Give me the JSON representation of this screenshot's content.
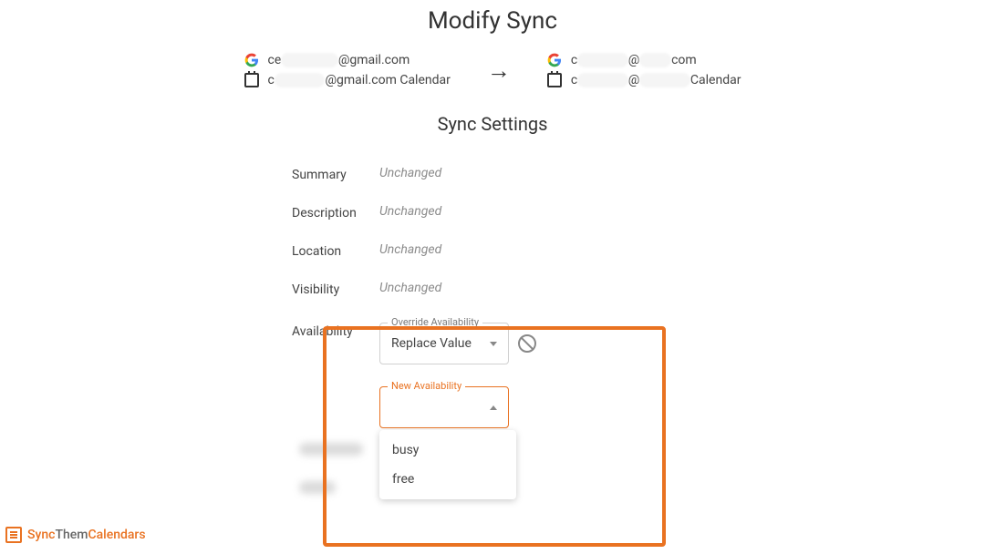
{
  "page_title": "Modify Sync",
  "source_account": {
    "email_prefix": "ce",
    "email_suffix": "@gmail.com",
    "calendar_prefix": "c",
    "calendar_suffix": "@gmail.com Calendar"
  },
  "dest_account": {
    "email_prefix": "c",
    "email_suffix_partial": "@",
    "email_end": "com",
    "calendar_prefix": "c",
    "calendar_suffix_partial": "@",
    "calendar_end": "Calendar"
  },
  "section_title": "Sync Settings",
  "settings": {
    "summary": {
      "label": "Summary",
      "value": "Unchanged"
    },
    "description": {
      "label": "Description",
      "value": "Unchanged"
    },
    "location": {
      "label": "Location",
      "value": "Unchanged"
    },
    "visibility": {
      "label": "Visibility",
      "value": "Unchanged"
    },
    "availability": {
      "label": "Availability"
    }
  },
  "override_dropdown": {
    "float_label": "Override Availability",
    "selected": "Replace Value"
  },
  "new_avail_dropdown": {
    "float_label": "New Availability",
    "selected": "",
    "options": [
      "busy",
      "free"
    ]
  },
  "brand": {
    "name_a": "Sync",
    "name_b": "Them",
    "name_c": "Calendars"
  }
}
